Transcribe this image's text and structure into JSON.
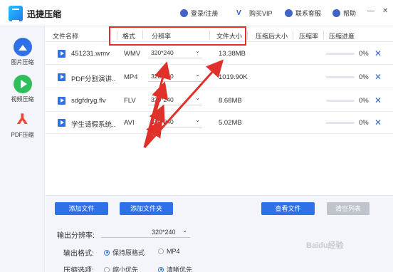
{
  "app": {
    "title": "迅捷压缩"
  },
  "header": {
    "login": "登录/注册",
    "vip": "购买VIP",
    "support": "联系客服",
    "help": "帮助"
  },
  "sidebar": {
    "items": [
      {
        "label": "图片压缩"
      },
      {
        "label": "视频压缩"
      },
      {
        "label": "PDF压缩"
      }
    ]
  },
  "table": {
    "columns": [
      "文件名称",
      "格式",
      "分辨率",
      "文件大小",
      "压缩后大小",
      "压缩率",
      "压缩进度"
    ],
    "rows": [
      {
        "name": "451231.wmv",
        "format": "WMV",
        "resolution": "320*240",
        "size": "13.38MB",
        "progress": "0%",
        "progress_value": 0
      },
      {
        "name": "PDF分割演讲...",
        "format": "MP4",
        "resolution": "320*240",
        "size": "1019.90KB",
        "progress": "0%",
        "progress_value": 0
      },
      {
        "name": "sdgfdryg.flv",
        "format": "FLV",
        "resolution": "320*240",
        "size": "8.68MB",
        "progress": "0%",
        "progress_value": 0
      },
      {
        "name": "学生请假系统...",
        "format": "AVI",
        "resolution": "320*240",
        "size": "5.02MB",
        "progress": "0%",
        "progress_value": 0
      }
    ]
  },
  "buttons": {
    "add_file": "添加文件",
    "add_folder": "添加文件夹",
    "view_file": "查看文件",
    "clear_list": "清空列表"
  },
  "settings": {
    "resolution_label": "输出分辨率:",
    "resolution_value": "320*240",
    "format_label": "输出格式:",
    "format_options": [
      "保持原格式",
      "MP4"
    ],
    "compress_label": "压缩选项:",
    "compress_options": [
      "缩小优先",
      "清晰优先"
    ]
  },
  "watermark": "Baidu经验",
  "colors": {
    "accent": "#2f6fe8",
    "annotation": "#e0302a"
  }
}
